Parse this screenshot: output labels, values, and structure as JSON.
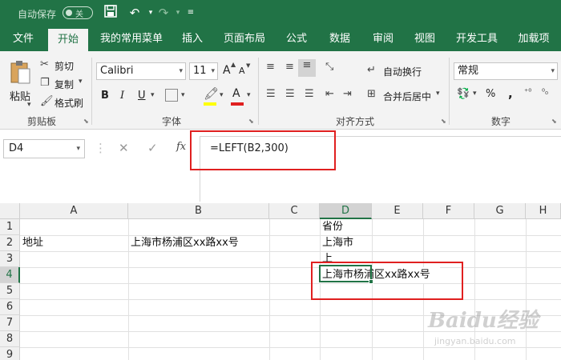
{
  "titlebar": {
    "autosave_label": "自动保存",
    "autosave_state": "关",
    "save_icon": "save-icon",
    "undo_icon": "undo-icon",
    "redo_icon": "redo-icon",
    "customize_icon": "chevron-down-icon"
  },
  "ribbon_tabs": [
    "文件",
    "开始",
    "我的常用菜单",
    "插入",
    "页面布局",
    "公式",
    "数据",
    "审阅",
    "视图",
    "开发工具",
    "加载项"
  ],
  "active_tab": "开始",
  "ribbon": {
    "clipboard": {
      "paste": "粘贴",
      "cut": "剪切",
      "copy": "复制",
      "format_painter": "格式刷",
      "label": "剪贴板"
    },
    "font": {
      "name": "Calibri",
      "size": "11",
      "bold": "B",
      "italic": "I",
      "underline": "U",
      "grow": "A",
      "shrink": "A",
      "label": "字体",
      "highlight_color": "#ffff00",
      "font_color": "#e02020"
    },
    "alignment": {
      "wrap_text": "自动换行",
      "merge_center": "合并后居中",
      "label": "对齐方式"
    },
    "number": {
      "format": "常规",
      "percent": "%",
      "comma": ",",
      "label": "数字"
    }
  },
  "formula_bar": {
    "name_box": "D4",
    "cancel": "✕",
    "enter": "✓",
    "fx": "fx",
    "formula": "=LEFT(B2,300)"
  },
  "sheet": {
    "columns": [
      "A",
      "B",
      "C",
      "D",
      "E",
      "F",
      "G",
      "H"
    ],
    "rows": [
      "1",
      "2",
      "3",
      "4",
      "5",
      "6",
      "7",
      "8",
      "9"
    ],
    "selected_column": "D",
    "selected_row": "4",
    "cells": {
      "D1": "省份",
      "A2": "地址",
      "B2": "上海市杨浦区xx路xx号",
      "D2": "上海市",
      "D3": "上",
      "D4": "上海市杨浦区xx路xx号"
    }
  },
  "watermark": {
    "main": "Baidu经验",
    "sub": "jingyan.baidu.com"
  },
  "colors": {
    "excel_green": "#217346",
    "annotation_red": "#e02020"
  }
}
